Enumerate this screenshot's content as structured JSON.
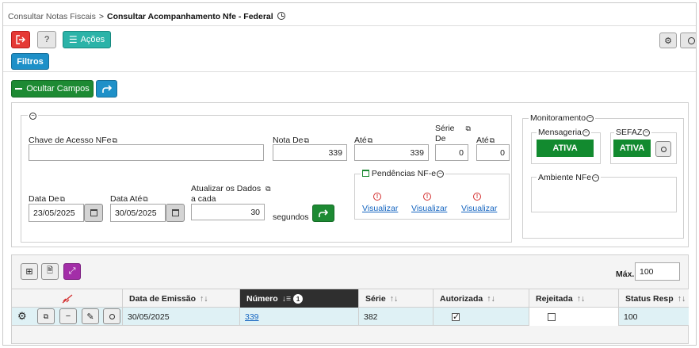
{
  "breadcrumb": {
    "parent": "Consultar Notas Fiscais",
    "separator": ">",
    "current": "Consultar Acompanhamento Nfe - Federal"
  },
  "toolbar": {
    "help_label": "?",
    "actions_label": "Ações"
  },
  "filters_label": "Filtros",
  "hide_fields_label": "Ocultar Campos",
  "form": {
    "chave_label": "Chave de Acesso NFe",
    "chave_value": "",
    "nota_de_label": "Nota De",
    "nota_de_value": "339",
    "ate_label": "Até",
    "ate_value": "339",
    "serie_de_label_1": "Série",
    "serie_de_label_2": "De",
    "serie_de_value": "0",
    "serie_ate_label": "Até",
    "serie_ate_value": "0",
    "data_de_label": "Data De",
    "data_de_value": "23/05/2025",
    "data_ate_label": "Data Até",
    "data_ate_value": "30/05/2025",
    "atualizar_label_1": "Atualizar os Dados",
    "atualizar_label_2": "a cada",
    "atualizar_value": "30",
    "segundos_label": "segundos",
    "pendencias_label": "Pendências NF-e",
    "visualizar": [
      "Visualizar",
      "Visualizar",
      "Visualizar"
    ]
  },
  "monitor": {
    "title": "Monitoramento",
    "mensageria_label": "Mensageria",
    "mensageria_status": "ATIVA",
    "sefaz_label": "SEFAZ",
    "sefaz_status": "ATIVA",
    "ambiente_label": "Ambiente NFe"
  },
  "grid": {
    "max_label": "Máx.",
    "max_value": "100",
    "columns": [
      "Data de Emissão",
      "Número",
      "Série",
      "Autorizada",
      "Rejeitada",
      "Status Resp"
    ],
    "sort_badge": "1",
    "row": {
      "data": "30/05/2025",
      "numero": "339",
      "serie": "382",
      "status": "100"
    }
  },
  "colors": {
    "accent_red": "#e53935",
    "accent_teal": "#2bb3a8",
    "accent_blue": "#1e90c8",
    "accent_green": "#1d8a33",
    "header_dark": "#2f2f2f",
    "row_highlight": "#dff1f5"
  }
}
